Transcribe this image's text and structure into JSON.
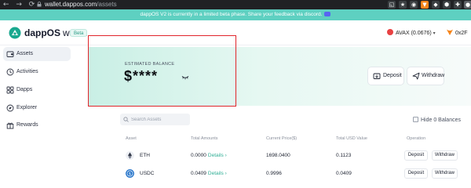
{
  "browser": {
    "nav_glyphs": "← → ⟳",
    "url_host": "wallet.dappos.com",
    "url_path": "/assets"
  },
  "banner": {
    "text": "dappOS V2 is currently in a limited beta phase. Share your feedback via discord."
  },
  "header": {
    "logo_name": "dappOS",
    "logo_suffix": "wallet",
    "beta_badge": "Beta",
    "chain_label": "AVAX (0.0676)",
    "account_label": "0x2F"
  },
  "sidebar": {
    "items": [
      {
        "label": "Assets",
        "icon": "wallet-icon",
        "active": true
      },
      {
        "label": "Activities",
        "icon": "activity-icon",
        "active": false
      },
      {
        "label": "Dapps",
        "icon": "grid-icon",
        "active": false
      },
      {
        "label": "Explorer",
        "icon": "compass-icon",
        "active": false
      },
      {
        "label": "Rewards",
        "icon": "gift-icon",
        "active": false
      }
    ]
  },
  "balance_card": {
    "label": "ESTIMATED BALANCE",
    "value": "$****",
    "deposit_label": "Deposit",
    "withdraw_label": "Withdraw"
  },
  "assets": {
    "search_placeholder": "Search Assets",
    "hide_zero_label": "Hide 0 Balances",
    "columns": [
      "Asset",
      "Total Amounts",
      "Current Price($)",
      "Total USD Value",
      "Operation"
    ],
    "rows": [
      {
        "symbol": "ETH",
        "amount": "0.0000",
        "details": "Details",
        "price": "1698.0400",
        "usd": "0.1123",
        "deposit": "Deposit",
        "withdraw": "Withdraw"
      },
      {
        "symbol": "USDC",
        "amount": "0.0409",
        "details": "Details",
        "price": "0.9996",
        "usd": "0.0409",
        "deposit": "Deposit",
        "withdraw": "Withdraw"
      }
    ]
  },
  "colors": {
    "accent_teal": "#2fae95",
    "banner": "#5ed0c1",
    "highlight_red": "#e0252b",
    "avax_red": "#e84142"
  }
}
